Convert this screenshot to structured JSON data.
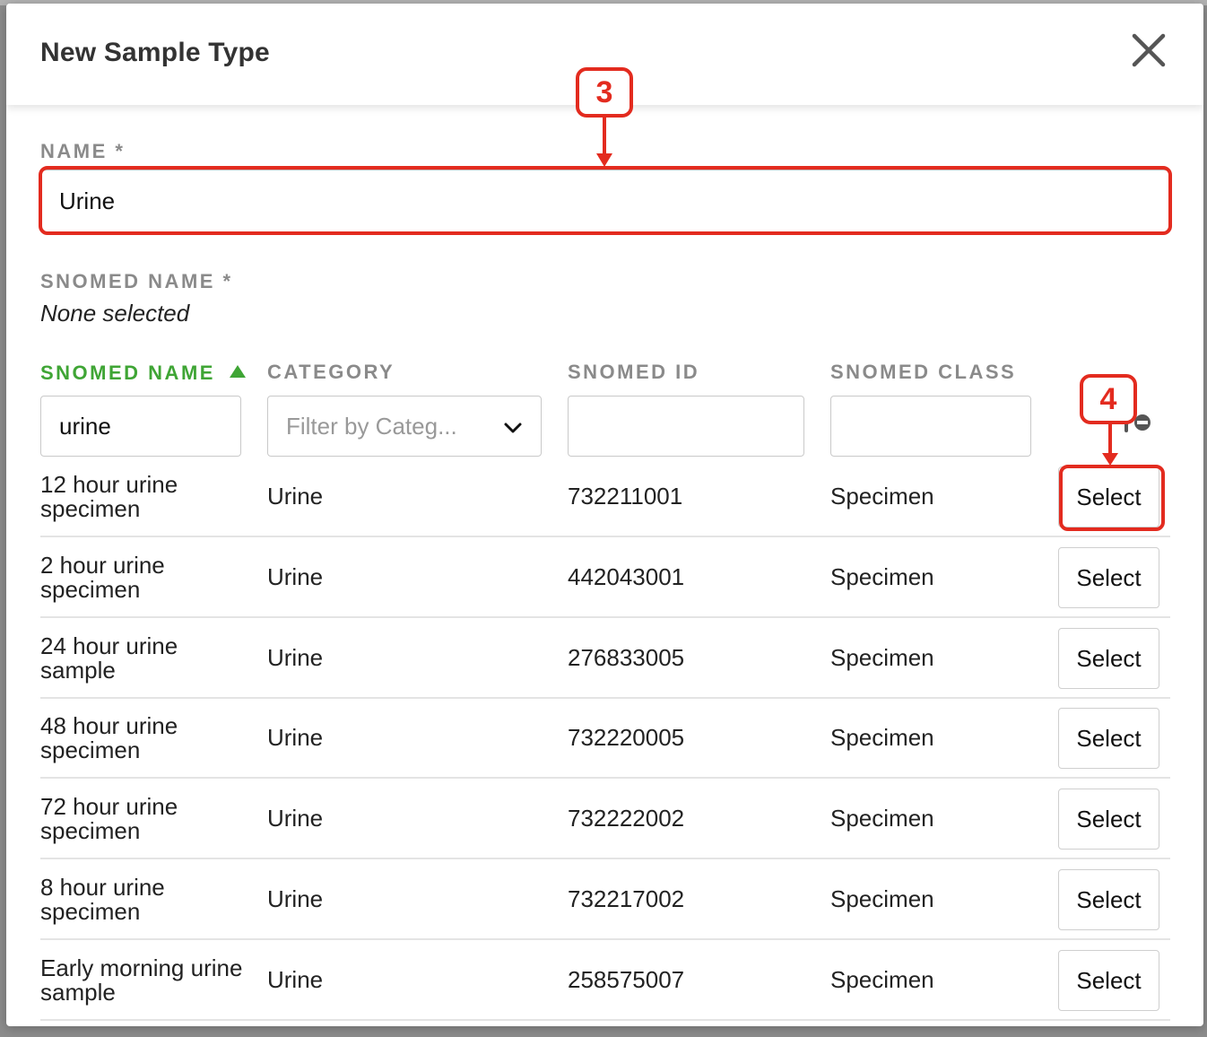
{
  "modal": {
    "title": "New Sample Type",
    "close_icon": "close-icon"
  },
  "form": {
    "name_label": "NAME *",
    "name_value": "Urine",
    "snomed_label": "SNOMED NAME *",
    "snomed_value": "None selected"
  },
  "table": {
    "headers": {
      "name": "SNOMED NAME",
      "category": "CATEGORY",
      "snomed_id": "SNOMED ID",
      "snomed_class": "SNOMED CLASS"
    },
    "sort_icon": "sort-ascending-icon",
    "filters": {
      "name_value": "urine",
      "category_placeholder": "Filter by Categ...",
      "snomed_id_value": "",
      "snomed_class_value": ""
    },
    "select_label": "Select",
    "rows": [
      {
        "name": "12 hour urine specimen",
        "category": "Urine",
        "snomed_id": "732211001",
        "snomed_class": "Specimen"
      },
      {
        "name": "2 hour urine specimen",
        "category": "Urine",
        "snomed_id": "442043001",
        "snomed_class": "Specimen"
      },
      {
        "name": "24 hour urine sample",
        "category": "Urine",
        "snomed_id": "276833005",
        "snomed_class": "Specimen"
      },
      {
        "name": "48 hour urine specimen",
        "category": "Urine",
        "snomed_id": "732220005",
        "snomed_class": "Specimen"
      },
      {
        "name": "72 hour urine specimen",
        "category": "Urine",
        "snomed_id": "732222002",
        "snomed_class": "Specimen"
      },
      {
        "name": "8 hour urine specimen",
        "category": "Urine",
        "snomed_id": "732217002",
        "snomed_class": "Specimen"
      },
      {
        "name": "Early morning urine sample",
        "category": "Urine",
        "snomed_id": "258575007",
        "snomed_class": "Specimen"
      }
    ]
  },
  "annotations": {
    "step_3": "3",
    "step_4": "4",
    "color": "#e32b1f"
  },
  "colors": {
    "accent_green": "#3fa535",
    "label_gray": "#8a8a8a"
  }
}
